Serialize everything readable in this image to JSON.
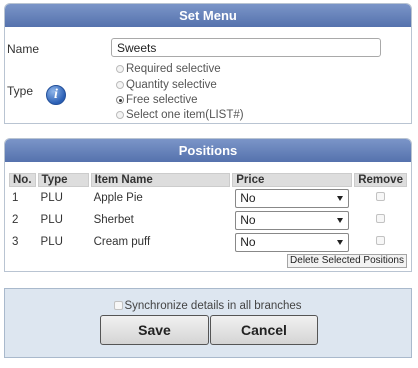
{
  "set_menu": {
    "title": "Set Menu",
    "name_label": "Name",
    "name_value": "Sweets",
    "type_label": "Type",
    "info_icon": "info-icon",
    "type_options": [
      {
        "label": "Required selective",
        "checked": false
      },
      {
        "label": "Quantity selective",
        "checked": false
      },
      {
        "label": "Free selective",
        "checked": true
      },
      {
        "label": "Select one item(LIST#)",
        "checked": false
      }
    ]
  },
  "positions": {
    "title": "Positions",
    "columns": [
      "No.",
      "Type",
      "Item Name",
      "Price",
      "Remove"
    ],
    "rows": [
      {
        "no": "1",
        "type": "PLU",
        "item": "Apple Pie",
        "price": "No"
      },
      {
        "no": "2",
        "type": "PLU",
        "item": "Sherbet",
        "price": "No"
      },
      {
        "no": "3",
        "type": "PLU",
        "item": "Cream puff",
        "price": "No"
      }
    ],
    "delete_label": "Delete Selected Positions"
  },
  "footer": {
    "sync_label": "Synchronize details in all branches",
    "save_label": "Save",
    "cancel_label": "Cancel"
  },
  "colors": {
    "header_bar": "#5f7cb7",
    "footer_bg": "#dde6f0"
  }
}
